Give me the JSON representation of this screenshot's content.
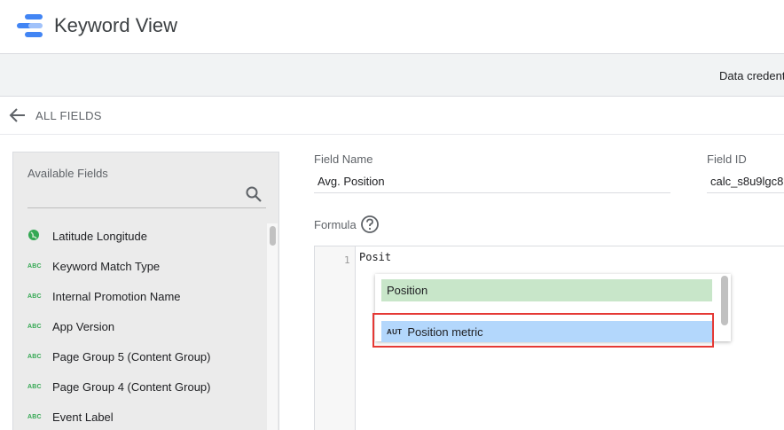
{
  "app": {
    "title": "Keyword View"
  },
  "toolbar": {
    "credentials_label": "Data credent"
  },
  "nav": {
    "back_label": "ALL FIELDS"
  },
  "available_fields": {
    "label": "Available Fields",
    "items": [
      {
        "type": "geo-icon",
        "label": "Latitude Longitude"
      },
      {
        "type": "ABC",
        "label": "Keyword Match Type"
      },
      {
        "type": "ABC",
        "label": "Internal Promotion Name"
      },
      {
        "type": "ABC",
        "label": "App Version"
      },
      {
        "type": "ABC",
        "label": "Page Group 5 (Content Group)"
      },
      {
        "type": "ABC",
        "label": "Page Group 4 (Content Group)"
      },
      {
        "type": "ABC",
        "label": "Event Label"
      }
    ]
  },
  "field_name": {
    "label": "Field Name",
    "value": "Avg. Position"
  },
  "field_id": {
    "label": "Field ID",
    "value": "calc_s8u9lgc8"
  },
  "formula": {
    "label": "Formula",
    "line_number": "1",
    "code": "Posit"
  },
  "autocomplete": {
    "items": [
      {
        "type": "",
        "label": "Position"
      },
      {
        "type": "AUT",
        "label": "Position metric"
      }
    ]
  },
  "colors": {
    "accent_blue": "#4285f4",
    "type_green": "#34a853",
    "highlight_red": "#e53935"
  }
}
